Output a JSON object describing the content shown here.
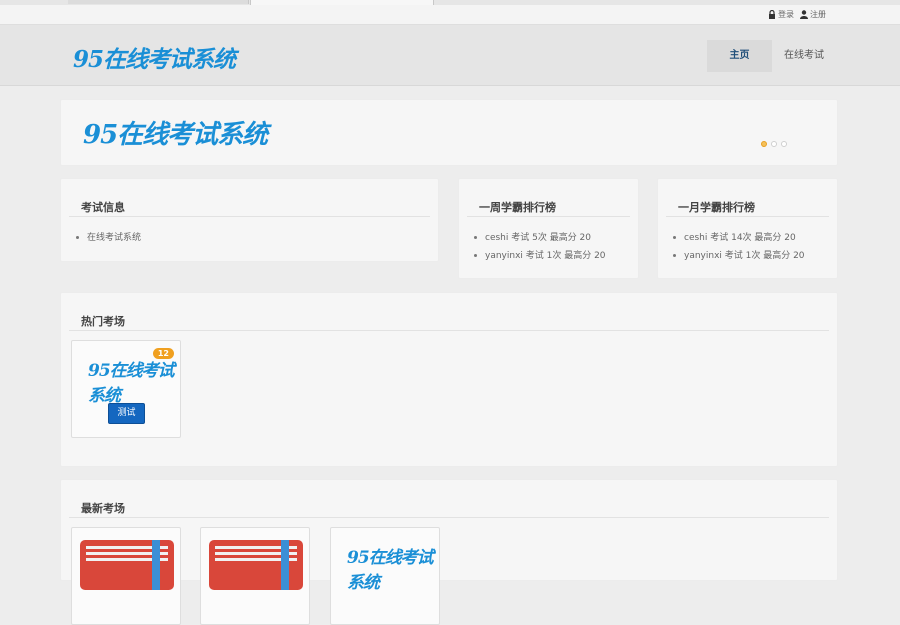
{
  "topbar": {
    "login_label": "登录",
    "register_label": "注册"
  },
  "header": {
    "logo_text": "95在线考试系统",
    "nav": [
      {
        "label": "主页",
        "active": true
      },
      {
        "label": "在线考试",
        "active": false
      }
    ]
  },
  "banner": {
    "logo_text": "95在线考试系统",
    "slides": 3,
    "active_slide": 1
  },
  "exam_info": {
    "title": "考试信息",
    "items": [
      "在线考试系统"
    ]
  },
  "weekly_rank": {
    "title": "一周学霸排行榜",
    "items": [
      "ceshi 考试 5次 最高分 20",
      "yanyinxi 考试 1次 最高分 20"
    ]
  },
  "monthly_rank": {
    "title": "一月学霸排行榜",
    "items": [
      "ceshi 考试 14次 最高分 20",
      "yanyinxi 考试 1次 最高分 20"
    ]
  },
  "hot": {
    "title": "热门考场",
    "cards": [
      {
        "logo_text": "95在线考试系统",
        "badge": "12",
        "button": "测试"
      }
    ]
  },
  "latest": {
    "title": "最新考场",
    "cards": [
      {
        "type": "book"
      },
      {
        "type": "book"
      },
      {
        "type": "logo",
        "logo_text": "95在线考试系统"
      }
    ]
  },
  "colors": {
    "accent": "#1a8fd6",
    "button": "#1467c0",
    "badge": "#f0a020",
    "book": "#d9473a"
  },
  "icons": {
    "login": "lock-icon",
    "register": "user-icon"
  }
}
